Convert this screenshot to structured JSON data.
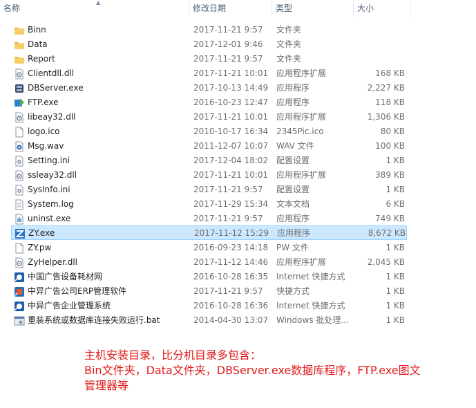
{
  "columns": {
    "name": "名称",
    "date": "修改日期",
    "type": "类型",
    "size": "大小"
  },
  "files": [
    {
      "icon": "folder-icon",
      "name": "Binn",
      "date": "2017-11-21 9:57",
      "type": "文件夹",
      "size": ""
    },
    {
      "icon": "folder-icon",
      "name": "Data",
      "date": "2017-12-01 9:46",
      "type": "文件夹",
      "size": ""
    },
    {
      "icon": "folder-icon",
      "name": "Report",
      "date": "2017-11-21 9:57",
      "type": "文件夹",
      "size": ""
    },
    {
      "icon": "dll-icon",
      "name": "Clientdll.dll",
      "date": "2017-11-21 10:01",
      "type": "应用程序扩展",
      "size": "168 KB"
    },
    {
      "icon": "server-exe-icon",
      "name": "DBServer.exe",
      "date": "2017-10-13 14:49",
      "type": "应用程序",
      "size": "2,227 KB"
    },
    {
      "icon": "ftp-exe-icon",
      "name": "FTP.exe",
      "date": "2016-10-23 12:47",
      "type": "应用程序",
      "size": "118 KB"
    },
    {
      "icon": "dll-icon",
      "name": "libeay32.dll",
      "date": "2017-11-21 10:01",
      "type": "应用程序扩展",
      "size": "1,306 KB"
    },
    {
      "icon": "file-icon",
      "name": "logo.ico",
      "date": "2010-10-17 16:34",
      "type": "2345Pic.ico",
      "size": "80 KB"
    },
    {
      "icon": "audio-file-icon",
      "name": "Msg.wav",
      "date": "2011-12-07 10:07",
      "type": "WAV 文件",
      "size": "100 KB"
    },
    {
      "icon": "ini-file-icon",
      "name": "Setting.ini",
      "date": "2017-12-04 18:02",
      "type": "配置设置",
      "size": "1 KB"
    },
    {
      "icon": "dll-icon",
      "name": "ssleay32.dll",
      "date": "2017-11-21 10:01",
      "type": "应用程序扩展",
      "size": "389 KB"
    },
    {
      "icon": "ini-file-icon",
      "name": "SysInfo.ini",
      "date": "2017-11-21 9:57",
      "type": "配置设置",
      "size": "1 KB"
    },
    {
      "icon": "text-file-icon",
      "name": "System.log",
      "date": "2017-11-29 15:34",
      "type": "文本文档",
      "size": "6 KB"
    },
    {
      "icon": "uninstall-exe-icon",
      "name": "uninst.exe",
      "date": "2017-11-21 9:57",
      "type": "应用程序",
      "size": "749 KB"
    },
    {
      "icon": "zy-exe-icon",
      "name": "ZY.exe",
      "date": "2017-11-12 15:29",
      "type": "应用程序",
      "size": "8,672 KB",
      "selected": true
    },
    {
      "icon": "file-icon",
      "name": "ZY.pw",
      "date": "2016-09-23 14:18",
      "type": "PW 文件",
      "size": "1 KB"
    },
    {
      "icon": "dll-icon",
      "name": "ZyHelper.dll",
      "date": "2017-11-12 14:46",
      "type": "应用程序扩展",
      "size": "2,045 KB"
    },
    {
      "icon": "internet-shortcut-icon",
      "name": "中国广告设备耗材网",
      "date": "2016-10-28 16:35",
      "type": "Internet 快捷方式",
      "size": "1 KB"
    },
    {
      "icon": "shortcut-icon",
      "name": "中异广告公司ERP管理软件",
      "date": "2017-11-21 9:57",
      "type": "快捷方式",
      "size": "1 KB"
    },
    {
      "icon": "internet-shortcut-icon",
      "name": "中异广告企业管理系统",
      "date": "2016-10-28 16:36",
      "type": "Internet 快捷方式",
      "size": "1 KB"
    },
    {
      "icon": "batch-file-icon",
      "name": "重装系统或数据库连接失败运行.bat",
      "date": "2014-04-30 13:07",
      "type": "Windows 批处理...",
      "size": "1 KB"
    }
  ],
  "annotation": {
    "line1": "主机安装目录，比分机目录多包含：",
    "line2": "Bin文件夹，Data文件夹，DBServer.exe数据库程序，FTP.exe图文",
    "line3": "管理器等"
  }
}
